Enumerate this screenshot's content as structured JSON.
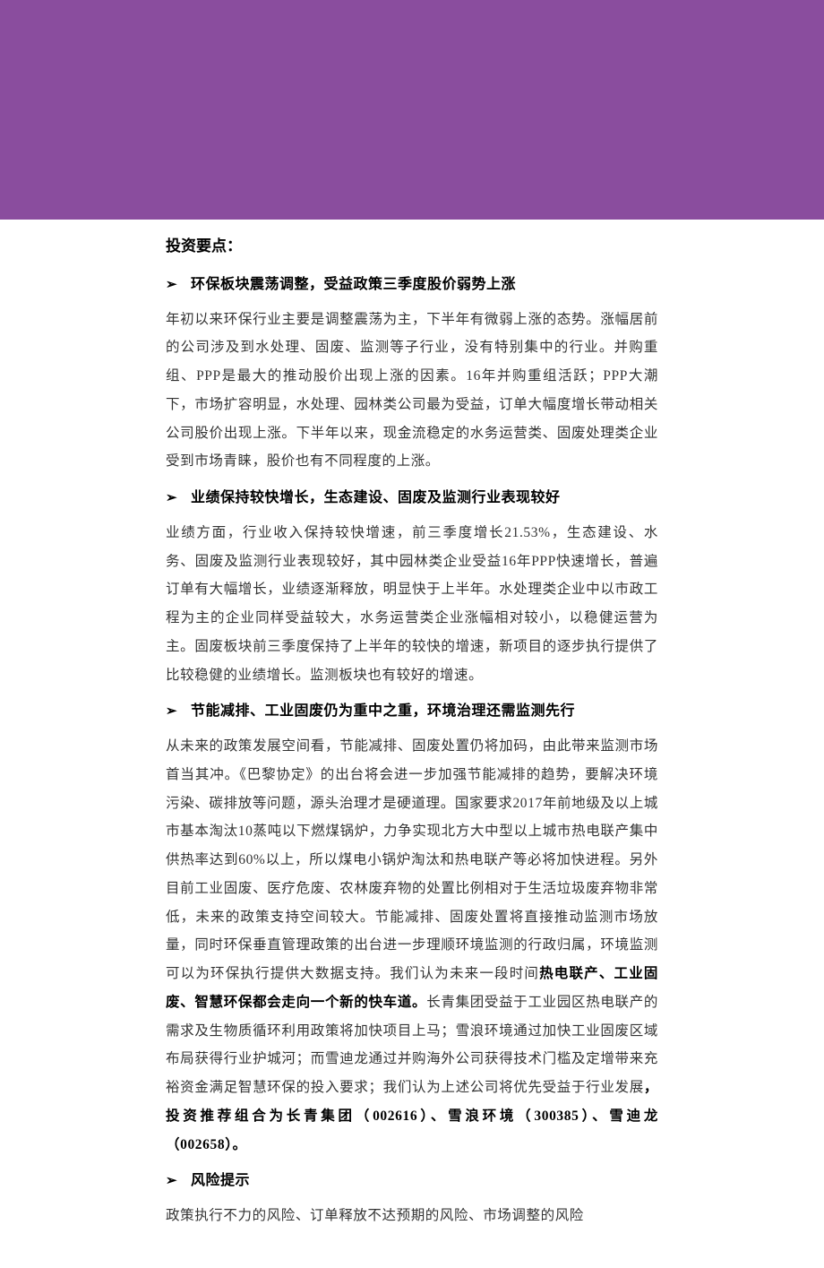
{
  "main_title": "投资要点：",
  "sections": [
    {
      "heading": "环保板块震荡调整，受益政策三季度股价弱势上涨",
      "body_plain": "年初以来环保行业主要是调整震荡为主，下半年有微弱上涨的态势。涨幅居前的公司涉及到水处理、固废、监测等子行业，没有特别集中的行业。并购重组、PPP是最大的推动股价出现上涨的因素。16年并购重组活跃；PPP大潮下，市场扩容明显，水处理、园林类公司最为受益，订单大幅度增长带动相关公司股价出现上涨。下半年以来，现金流稳定的水务运营类、固废处理类企业受到市场青睐，股价也有不同程度的上涨。"
    },
    {
      "heading": "业绩保持较快增长，生态建设、固废及监测行业表现较好",
      "body_plain": "业绩方面，行业收入保持较快增速，前三季度增长21.53%，生态建设、水务、固废及监测行业表现较好，其中园林类企业受益16年PPP快速增长，普遍订单有大幅增长，业绩逐渐释放，明显快于上半年。水处理类企业中以市政工程为主的企业同样受益较大，水务运营类企业涨幅相对较小，以稳健运营为主。固废板块前三季度保持了上半年的较快的增速，新项目的逐步执行提供了比较稳健的业绩增长。监测板块也有较好的增速。"
    },
    {
      "heading": "节能减排、工业固废仍为重中之重，环境治理还需监测先行",
      "body_pre": "从未来的政策发展空间看，节能减排、固废处置仍将加码，由此带来监测市场首当其冲。《巴黎协定》的出台将会进一步加强节能减排的趋势，要解决环境污染、碳排放等问题，源头治理才是硬道理。国家要求2017年前地级及以上城市基本淘汰10蒸吨以下燃煤锅炉，力争实现北方大中型以上城市热电联产集中供热率达到60%以上，所以煤电小锅炉淘汰和热电联产等必将加快进程。另外目前工业固废、医疗危废、农林废弃物的处置比例相对于生活垃圾废弃物非常低，未来的政策支持空间较大。节能减排、固废处置将直接推动监测市场放量，同时环保垂直管理政策的出台进一步理顺环境监测的行政归属，环境监测可以为环保执行提供大数据支持。我们认为未来一段时间",
      "bold1": "热电联产、工业固废、智慧环保都会走向一个新的快车道。",
      "body_mid": "长青集团受益于工业园区热电联产的需求及生物质循环利用政策将加快项目上马；雪浪环境通过加快工业固废区域布局获得行业护城河；而雪迪龙通过并购海外公司获得技术门槛及定增带来充裕资金满足智慧环保的投入要求；我们认为上述公司将优先受益于行业发展",
      "bold2": "，投资推荐组合为长青集团（002616）、雪浪环境（300385）、雪迪龙（002658）。"
    },
    {
      "heading": "风险提示",
      "body_plain": "政策执行不力的风险、订单释放不达预期的风险、市场调整的风险"
    }
  ],
  "bullet_glyph": "➢"
}
